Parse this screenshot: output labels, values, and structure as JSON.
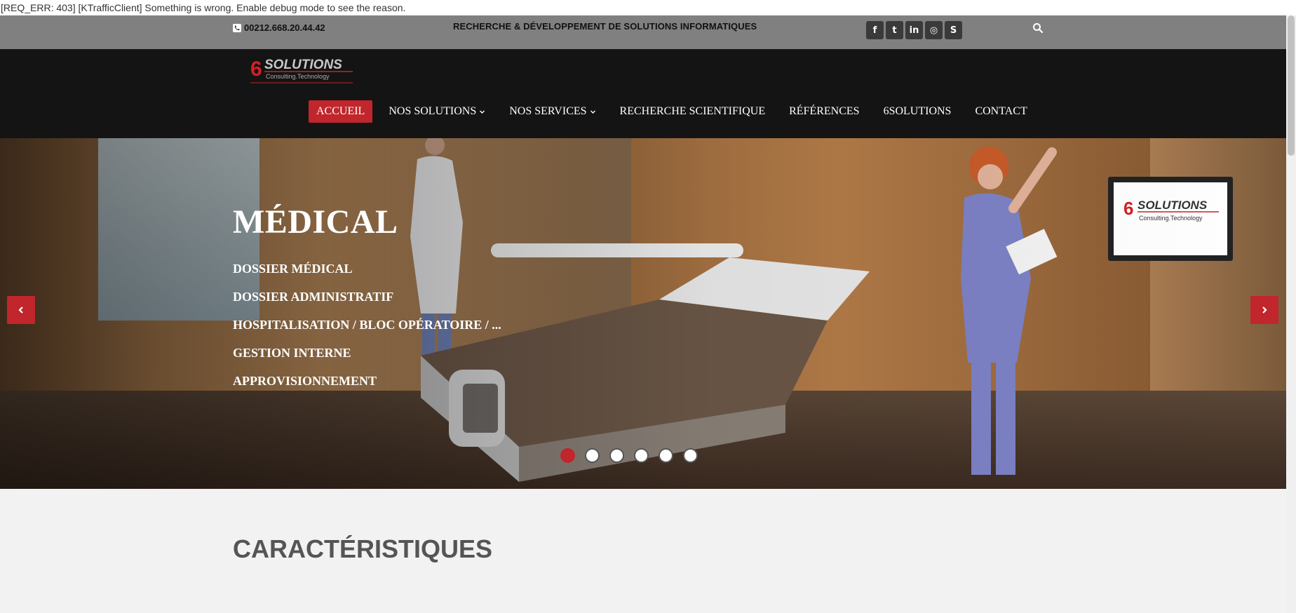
{
  "error_bar": {
    "text": "[REQ_ERR: 403] [KTrafficClient] Something is wrong. Enable debug mode to see the reason."
  },
  "topbar": {
    "phone": "00212.668.20.44.42",
    "tagline": "RECHERCHE & DÉVELOPPEMENT DE SOLUTIONS INFORMATIQUES",
    "socials": [
      {
        "name": "facebook-icon",
        "glyph": "f"
      },
      {
        "name": "twitter-icon",
        "glyph": "t"
      },
      {
        "name": "linkedin-icon",
        "glyph": "in"
      },
      {
        "name": "dribbble-icon",
        "glyph": "◎"
      },
      {
        "name": "skype-icon",
        "glyph": "S"
      }
    ]
  },
  "logo": {
    "brand": "SOLUTIONS",
    "digit": "6",
    "tagline": "Consulting.Technology"
  },
  "nav": {
    "items": [
      {
        "label": "ACCUEIL",
        "active": true,
        "dropdown": false
      },
      {
        "label": "NOS SOLUTIONS",
        "active": false,
        "dropdown": true
      },
      {
        "label": "NOS SERVICES",
        "active": false,
        "dropdown": true
      },
      {
        "label": "RECHERCHE SCIENTIFIQUE",
        "active": false,
        "dropdown": false
      },
      {
        "label": "RÉFÉRENCES",
        "active": false,
        "dropdown": false
      },
      {
        "label": "6SOLUTIONS",
        "active": false,
        "dropdown": false
      },
      {
        "label": "CONTACT",
        "active": false,
        "dropdown": false
      }
    ]
  },
  "slider": {
    "title": "MÉDICAL",
    "items": [
      "DOSSIER MÉDICAL",
      "DOSSIER ADMINISTRATIF",
      "HOSPITALISATION / BLOC OPÉRATOIRE / ...",
      "GESTION INTERNE",
      "APPROVISIONNEMENT"
    ],
    "dots_total": 6,
    "active_index": 0
  },
  "section": {
    "title": "CARACTÉRISTIQUES"
  },
  "colors": {
    "accent": "#c0262c",
    "topbar_bg": "#808080",
    "header_bg": "#141414"
  }
}
